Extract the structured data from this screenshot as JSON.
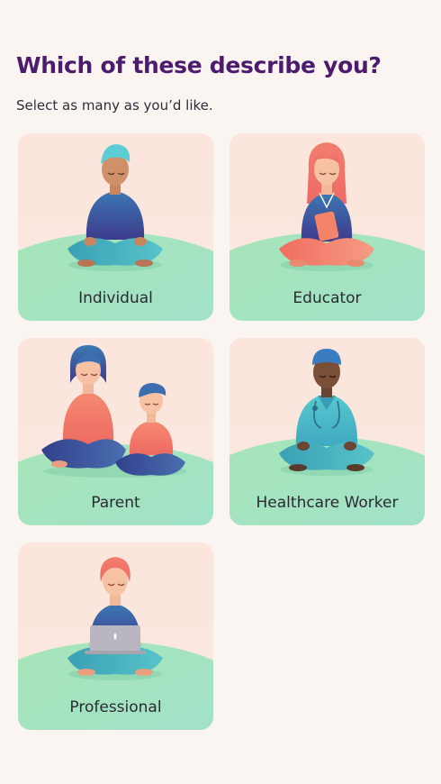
{
  "header": {
    "title": "Which of these describe you?",
    "subtitle": "Select as many as you’d like."
  },
  "options": [
    {
      "label": "Individual",
      "icon": "meditating-person-illustration"
    },
    {
      "label": "Educator",
      "icon": "meditating-educator-illustration"
    },
    {
      "label": "Parent",
      "icon": "meditating-parent-and-child-illustration"
    },
    {
      "label": "Healthcare Worker",
      "icon": "meditating-healthcare-worker-illustration"
    },
    {
      "label": "Professional",
      "icon": "meditating-professional-with-laptop-illustration"
    }
  ],
  "colors": {
    "title": "#4c1b6e",
    "card_background": "#fbe5dc",
    "hill_green": "#9fe3bf",
    "page_background": "#fbf5f2"
  }
}
